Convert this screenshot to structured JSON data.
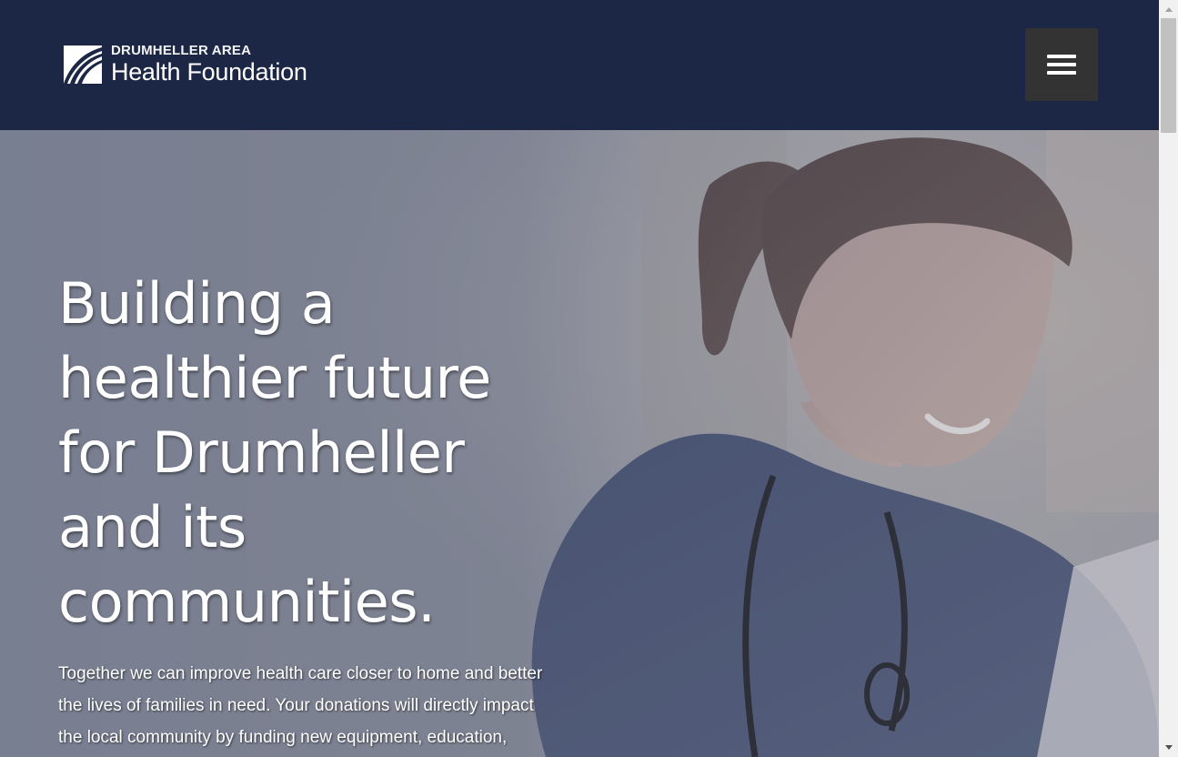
{
  "header": {
    "logo_line1": "DRUMHELLER AREA",
    "logo_line2": "Health Foundation",
    "menu_icon": "hamburger-icon",
    "background_color": "#1c2746",
    "menu_button_color": "#333333"
  },
  "hero": {
    "heading": "Building a healthier future for Drumheller and its communities.",
    "text": "Together we can improve health care closer to home and better the lives of families in need. Your donations will directly impact the local community by funding new equipment, education, health programs and overall improving the quality"
  },
  "scrollbar": {
    "up_icon": "scroll-up-arrow-icon",
    "down_icon": "scroll-down-arrow-icon"
  }
}
